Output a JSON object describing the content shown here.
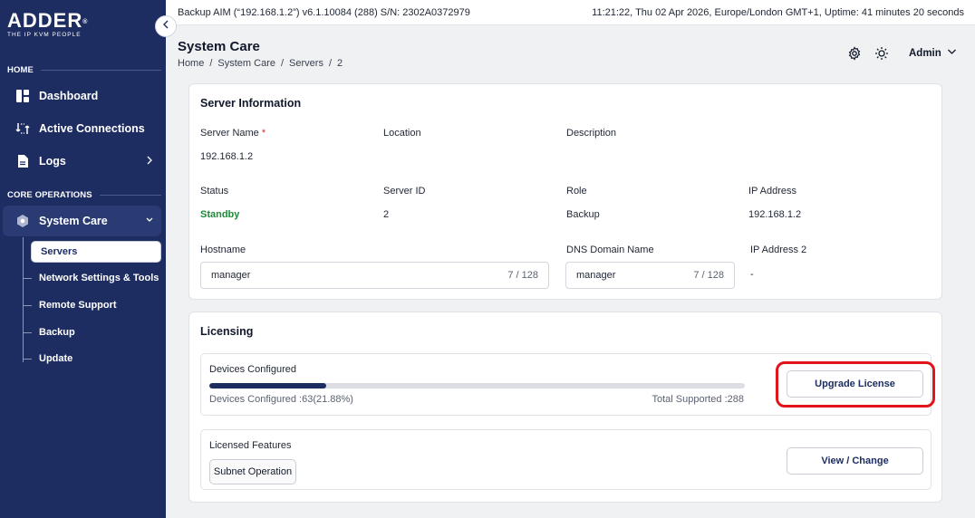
{
  "sidebar": {
    "brand": "ADDER",
    "brand_mark": "®",
    "tagline": "THE IP KVM PEOPLE",
    "sections": {
      "home": "HOME",
      "core": "CORE OPERATIONS"
    },
    "items": {
      "dashboard": "Dashboard",
      "active_connections": "Active Connections",
      "logs": "Logs",
      "system_care": "System Care"
    },
    "sub_items": {
      "servers": "Servers",
      "network": "Network Settings & Tools",
      "remote_support": "Remote Support",
      "backup": "Backup",
      "update": "Update"
    }
  },
  "topbar": {
    "left": "Backup AIM (“192.168.1.2”) v6.1.10084 (288) S/N: 2302A0372979",
    "right": "11:21:22, Thu 02 Apr 2026, Europe/London GMT+1, Uptime: 41 minutes 20 seconds"
  },
  "header": {
    "title": "System Care",
    "breadcrumb": [
      "Home",
      "/",
      "System Care",
      "/",
      "Servers",
      "/",
      "2"
    ],
    "user": "Admin"
  },
  "server_info": {
    "title": "Server Information",
    "server_name_label": "Server Name",
    "required_mark": "*",
    "server_name": "192.168.1.2",
    "location_label": "Location",
    "description_label": "Description",
    "status_label": "Status",
    "status": "Standby",
    "server_id_label": "Server ID",
    "server_id": "2",
    "role_label": "Role",
    "role": "Backup",
    "ip_label": "IP Address",
    "ip": "192.168.1.2",
    "hostname_label": "Hostname",
    "hostname": "manager",
    "hostname_count": "7 / 128",
    "dns_label": "DNS Domain Name",
    "dns": "manager",
    "dns_count": "7 / 128",
    "ip2_label": "IP Address 2",
    "ip2": "-"
  },
  "licensing": {
    "title": "Licensing",
    "devices_label": "Devices Configured",
    "devices_text": "Devices Configured :63(21.88%)",
    "total_text": "Total Supported :288",
    "progress_fraction": 0.2188,
    "upgrade_button": "Upgrade License",
    "features_label": "Licensed Features",
    "feature_chip": "Subnet Operation",
    "view_button": "View / Change"
  },
  "colors": {
    "sidebar_bg": "#1d2d61",
    "accent": "#1d2d61",
    "status_green": "#1f8a3a",
    "highlight_red": "#e1141b"
  },
  "icons": [
    "dashboard-icon",
    "connections-icon",
    "logs-icon",
    "system-care-icon",
    "settings-gear-icon",
    "theme-sun-icon",
    "chevron-down-icon",
    "chevron-right-icon",
    "collapse-chevron-left-icon"
  ]
}
